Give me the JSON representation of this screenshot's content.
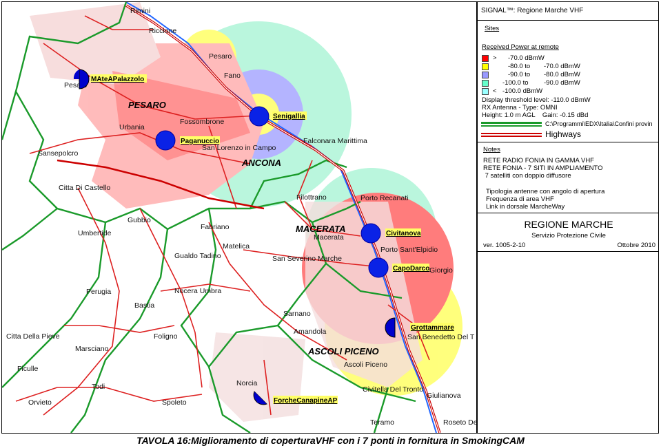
{
  "panel": {
    "title": "SIGNAL™: Regione Marche VHF",
    "sites_label": "Sites",
    "received_power_label": "Received Power at remote",
    "legend": [
      {
        "color": "#ff0000",
        "c1": ">",
        "c2": "-70.0 dBmW",
        "c3": "",
        "c4": ""
      },
      {
        "color": "#ffff00",
        "c1": "",
        "c2": "-80.0 to",
        "c3": "-70.0 dBmW",
        "c4": ""
      },
      {
        "color": "#9999ff",
        "c1": "",
        "c2": "-90.0 to",
        "c3": "-80.0 dBmW",
        "c4": ""
      },
      {
        "color": "#66ffcc",
        "c1": "",
        "c2": "-100.0 to",
        "c3": "-90.0 dBmW",
        "c4": ""
      },
      {
        "color": "#99ffff",
        "c1": "<",
        "c2": "-100.0 dBmW",
        "c3": "",
        "c4": ""
      }
    ],
    "threshold": "Display threshold level: -110.0 dBmW",
    "antenna": "RX Antenna - Type: OMNI",
    "height_gain": "Height: 1.0 m AGL    Gain: -0.15 dBd",
    "confini_path": "C:\\Programmi\\EDX\\Italia\\Confini provin",
    "highways_label": "Highways",
    "notes_label": "Notes",
    "notes": [
      "RETE RADIO FONIA IN GAMMA VHF",
      "RETE FONIA - 7 SITI IN AMPLIAMENTO",
      " 7 satelliti con doppio diffusore",
      "",
      "  Tipologia antenne con angolo di apertura",
      "  Frequenza di area VHF",
      "  Link in dorsale MarcheWay"
    ],
    "org_title": "REGIONE MARCHE",
    "org_subtitle": "Servizio Protezione Civile",
    "version": "ver. 1005-2-10",
    "date": "Ottobre 2010"
  },
  "map": {
    "provinces": [
      "PESARO",
      "ANCONA",
      "MACERATA",
      "ASCOLI PICENO"
    ],
    "towns": [
      "Rimini",
      "Riccione",
      "Pesaro",
      "Fano",
      "Pesaro",
      "Urbania",
      "Fossombrone",
      "San Lorenzo in Campo",
      "Falconara Marittima",
      "Sansepolcro",
      "Citta Di Castello",
      "Umbertide",
      "Gubbio",
      "Fabriano",
      "Matelica",
      "Gualdo Tadino",
      "San Severino Marche",
      "Filottrano",
      "Porto Recanati",
      "Macerata",
      "Porto Sant'Elpidio",
      "Giorgio",
      "Perugia",
      "Bastia",
      "Nocera Umbra",
      "Sarnano",
      "Amandola",
      "San Benedetto Del T",
      "Ascoli Piceno",
      "Citta Della Pieve",
      "Marsciano",
      "Foligno",
      "Ficulle",
      "Todi",
      "Spoleto",
      "Norcia",
      "Orvieto",
      "Civitella Del Tronto",
      "Giulianova",
      "Teramo",
      "Roseto De"
    ],
    "sites": [
      {
        "name": "MAteAPalazzolo",
        "type": "half"
      },
      {
        "name": "Paganuccio",
        "type": "full"
      },
      {
        "name": "Senigallia",
        "type": "full"
      },
      {
        "name": "Civitanova",
        "type": "full"
      },
      {
        "name": "CapoDarco",
        "type": "full"
      },
      {
        "name": "Grottammare",
        "type": "half"
      },
      {
        "name": "ForcheCanapineAP",
        "type": "half"
      }
    ]
  },
  "caption": "TAVOLA 16:Miglioramento di coperturaVHF con i 7 ponti in fornitura in SmokingCAM"
}
